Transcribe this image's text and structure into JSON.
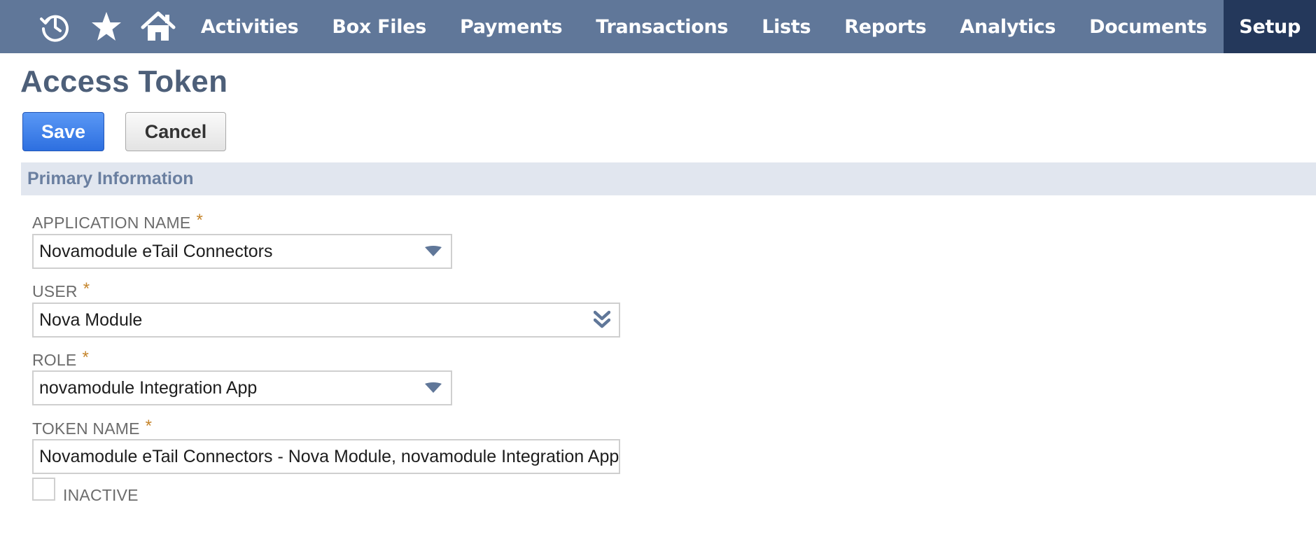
{
  "nav": {
    "icons": [
      "recent-records-icon",
      "star-icon",
      "home-icon"
    ],
    "items": [
      "Activities",
      "Box Files",
      "Payments",
      "Transactions",
      "Lists",
      "Reports",
      "Analytics",
      "Documents"
    ],
    "active_item": "Setup",
    "bar_color": "#607799",
    "active_color": "#24385b"
  },
  "page": {
    "title": "Access Token"
  },
  "toolbar": {
    "save_label": "Save",
    "cancel_label": "Cancel"
  },
  "section": {
    "title": "Primary Information"
  },
  "fields": {
    "application_name": {
      "label": "APPLICATION NAME",
      "required": "*",
      "value": "Novamodule eTail Connectors"
    },
    "user": {
      "label": "USER",
      "required": "*",
      "value": "Nova Module"
    },
    "role": {
      "label": "ROLE",
      "required": "*",
      "value": "novamodule Integration App"
    },
    "token_name": {
      "label": "TOKEN NAME",
      "required": "*",
      "value": "Novamodule eTail Connectors - Nova Module, novamodule Integration App"
    },
    "inactive": {
      "label": "INACTIVE",
      "checked": false
    }
  },
  "colors": {
    "required_star": "#c5852c",
    "save_button": "#2d6fe0",
    "section_header_bg": "#e1e6ef"
  }
}
